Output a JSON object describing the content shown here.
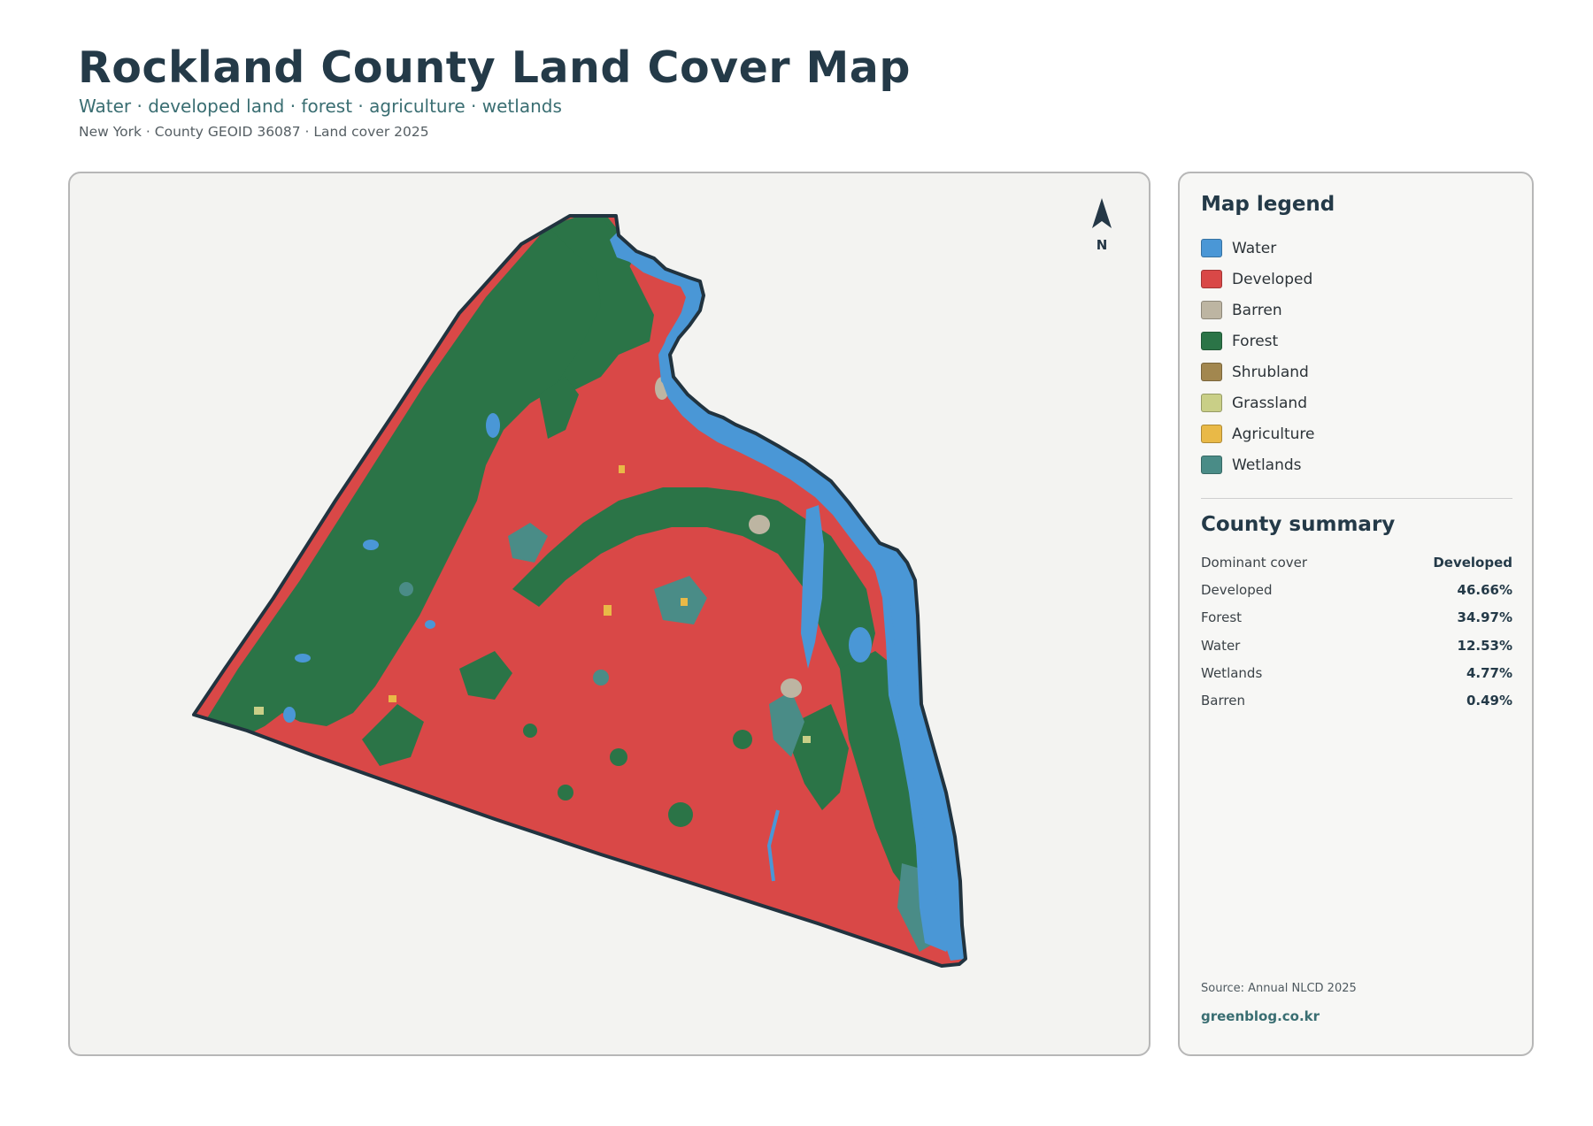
{
  "header": {
    "title": "Rockland County Land Cover Map",
    "subtitle": "Water · developed land · forest · agriculture · wetlands",
    "meta": "New York · County GEOID 36087 · Land cover 2025"
  },
  "map": {
    "north_label": "N",
    "colors": {
      "background": "#f3f3f1",
      "outline": "#21333f"
    }
  },
  "legend": {
    "title": "Map legend",
    "items": [
      {
        "label": "Water",
        "color": "#4a97d6"
      },
      {
        "label": "Developed",
        "color": "#d94847"
      },
      {
        "label": "Barren",
        "color": "#bdb5a2"
      },
      {
        "label": "Forest",
        "color": "#2b7447"
      },
      {
        "label": "Shrubland",
        "color": "#a2874f"
      },
      {
        "label": "Grassland",
        "color": "#c9cf87"
      },
      {
        "label": "Agriculture",
        "color": "#e9b947"
      },
      {
        "label": "Wetlands",
        "color": "#4a8c87"
      }
    ]
  },
  "summary": {
    "title": "County summary",
    "rows": [
      {
        "key": "Dominant cover",
        "value": "Developed"
      },
      {
        "key": "Developed",
        "value": "46.66%"
      },
      {
        "key": "Forest",
        "value": "34.97%"
      },
      {
        "key": "Water",
        "value": "12.53%"
      },
      {
        "key": "Wetlands",
        "value": "4.77%"
      },
      {
        "key": "Barren",
        "value": "0.49%"
      }
    ]
  },
  "footer": {
    "source": "Source: Annual NLCD 2025",
    "site": "greenblog.co.kr"
  }
}
